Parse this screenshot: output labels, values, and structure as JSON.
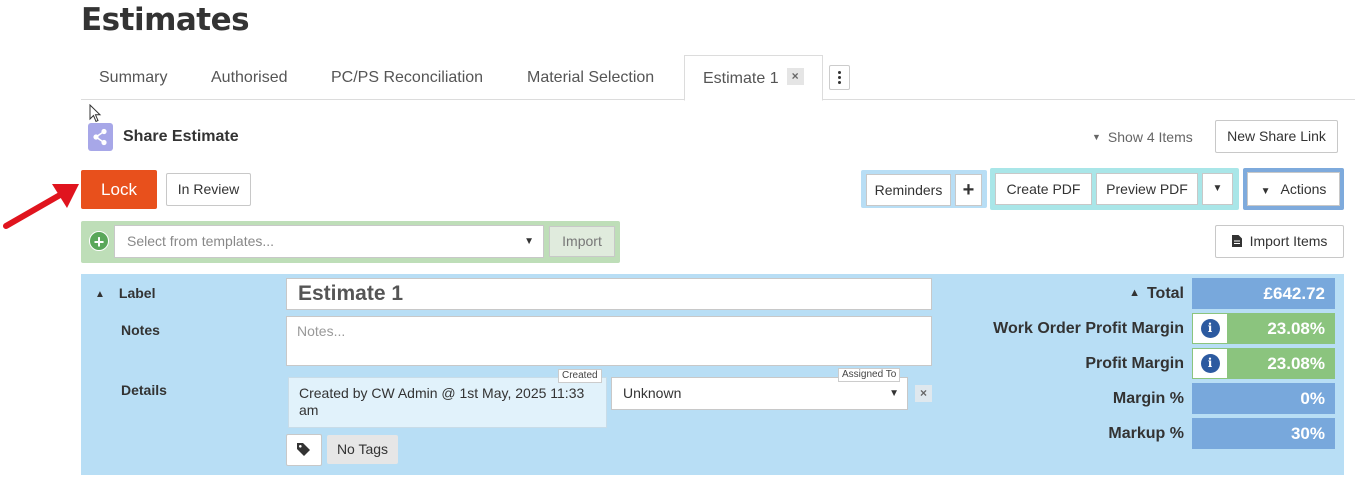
{
  "page": {
    "title": "Estimates"
  },
  "tabs": [
    {
      "label": "Summary"
    },
    {
      "label": "Authorised"
    },
    {
      "label": "PC/PS Reconciliation"
    },
    {
      "label": "Material Selection"
    },
    {
      "label": "Estimate 1",
      "active": true,
      "close": "×"
    }
  ],
  "share": {
    "title": "Share Estimate",
    "icon": "share-icon"
  },
  "toolbar": {
    "show_items": "Show 4 Items",
    "new_share_link": "New Share Link",
    "lock": "Lock",
    "in_review": "In Review",
    "reminders": "Reminders",
    "reminders_add": "+",
    "create_pdf": "Create PDF",
    "preview_pdf": "Preview PDF",
    "actions": "Actions",
    "import_items": "Import Items"
  },
  "templates": {
    "add": "+",
    "placeholder": "Select from templates...",
    "import": "Import"
  },
  "estimate": {
    "label_heading": "Label",
    "label_value": "Estimate 1",
    "notes_heading": "Notes",
    "notes_placeholder": "Notes...",
    "details_heading": "Details",
    "created_tag": "Created",
    "created_text": "Created by  CW Admin @ 1st May, 2025 11:33 am",
    "assigned_tag": "Assigned To",
    "assigned_value": "Unknown",
    "assigned_clear": "×",
    "no_tags": "No Tags"
  },
  "stats": {
    "total_label": "Total",
    "total_value": "£642.72",
    "wo_margin_label": "Work Order Profit Margin",
    "wo_margin_value": "23.08%",
    "profit_margin_label": "Profit Margin",
    "profit_margin_value": "23.08%",
    "margin_pct_label": "Margin %",
    "margin_pct_value": "0%",
    "markup_pct_label": "Markup %",
    "markup_pct_value": "30%",
    "info": "i"
  },
  "colors": {
    "lock": "#e8501c",
    "panel": "#b8def5",
    "stat_blue": "#78a8dc",
    "stat_green": "#8bc47e",
    "annotation_arrow": "#e0141e"
  }
}
